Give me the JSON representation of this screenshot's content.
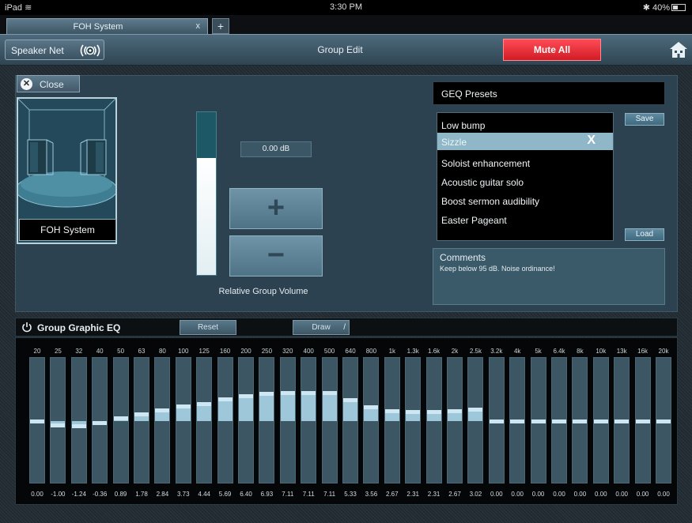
{
  "status": {
    "device": "iPad",
    "time": "3:30 PM",
    "battery": "40%"
  },
  "tabs": [
    {
      "label": "FOH System",
      "close": "x"
    }
  ],
  "tab_add": "+",
  "toolbar": {
    "speaker_net": "Speaker Net",
    "title": "Group Edit",
    "mute_all": "Mute All"
  },
  "left": {
    "close_label": "Close",
    "group_name": "FOH System"
  },
  "volume": {
    "readout": "0.00 dB",
    "label": "Relative Group Volume",
    "plus": "+",
    "minus": "−",
    "level": 0.72
  },
  "presets": {
    "title": "GEQ Presets",
    "items": [
      "Low bump",
      "Sizzle",
      "Soloist enhancement",
      "Acoustic guitar solo",
      "Boost sermon audibility",
      "Easter Pageant"
    ],
    "selected_index": 1,
    "delete_glyph": "X",
    "save": "Save",
    "load": "Load",
    "comments_title": "Comments",
    "comments_text": "Keep below 95 dB. Noise ordinance!"
  },
  "eq": {
    "title": "Group Graphic EQ",
    "reset": "Reset",
    "draw": "Draw",
    "bands": [
      {
        "freq": "20",
        "gain": "0.00",
        "value": 0.0
      },
      {
        "freq": "25",
        "gain": "-1.00",
        "value": -1.0
      },
      {
        "freq": "32",
        "gain": "-1.24",
        "value": -1.24
      },
      {
        "freq": "40",
        "gain": "-0.36",
        "value": -0.36
      },
      {
        "freq": "50",
        "gain": "0.89",
        "value": 0.89
      },
      {
        "freq": "63",
        "gain": "1.78",
        "value": 1.78
      },
      {
        "freq": "80",
        "gain": "2.84",
        "value": 2.84
      },
      {
        "freq": "100",
        "gain": "3.73",
        "value": 3.73
      },
      {
        "freq": "125",
        "gain": "4.44",
        "value": 4.44
      },
      {
        "freq": "160",
        "gain": "5.69",
        "value": 5.69
      },
      {
        "freq": "200",
        "gain": "6.40",
        "value": 6.4
      },
      {
        "freq": "250",
        "gain": "6.93",
        "value": 6.93
      },
      {
        "freq": "320",
        "gain": "7.11",
        "value": 7.11
      },
      {
        "freq": "400",
        "gain": "7.11",
        "value": 7.11
      },
      {
        "freq": "500",
        "gain": "7.11",
        "value": 7.11
      },
      {
        "freq": "640",
        "gain": "5.33",
        "value": 5.33
      },
      {
        "freq": "800",
        "gain": "3.56",
        "value": 3.56
      },
      {
        "freq": "1k",
        "gain": "2.67",
        "value": 2.67
      },
      {
        "freq": "1.3k",
        "gain": "2.31",
        "value": 2.31
      },
      {
        "freq": "1.6k",
        "gain": "2.31",
        "value": 2.31
      },
      {
        "freq": "2k",
        "gain": "2.67",
        "value": 2.67
      },
      {
        "freq": "2.5k",
        "gain": "3.02",
        "value": 3.02
      },
      {
        "freq": "3.2k",
        "gain": "0.00",
        "value": 0.0
      },
      {
        "freq": "4k",
        "gain": "0.00",
        "value": 0.0
      },
      {
        "freq": "5k",
        "gain": "0.00",
        "value": 0.0
      },
      {
        "freq": "6.4k",
        "gain": "0.00",
        "value": 0.0
      },
      {
        "freq": "8k",
        "gain": "0.00",
        "value": 0.0
      },
      {
        "freq": "10k",
        "gain": "0.00",
        "value": 0.0
      },
      {
        "freq": "13k",
        "gain": "0.00",
        "value": 0.0
      },
      {
        "freq": "16k",
        "gain": "0.00",
        "value": 0.0
      },
      {
        "freq": "20k",
        "gain": "0.00",
        "value": 0.0
      }
    ]
  },
  "colors": {
    "mute": "#e0202c",
    "accent": "#8fb7c8",
    "eq_bar": "#9fc7da"
  },
  "icons": {
    "speaker_net": "speaker-waves-icon",
    "home": "home-icon",
    "close": "close-circle-icon",
    "power": "power-icon",
    "draw": "pencil-icon",
    "wifi": "wifi-icon",
    "bluetooth": "bluetooth-icon"
  }
}
